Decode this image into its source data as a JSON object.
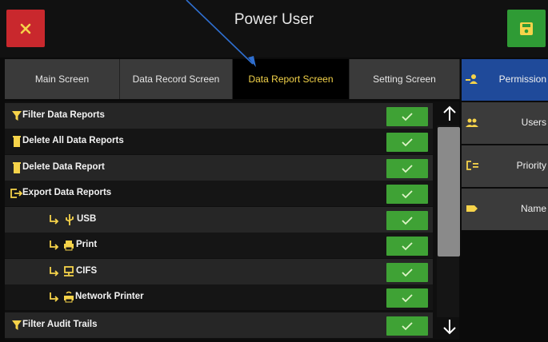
{
  "window": {
    "title": "Power User"
  },
  "tabs": [
    {
      "label": "Main Screen",
      "active": false
    },
    {
      "label": "Data Record Screen",
      "active": false
    },
    {
      "label": "Data Report Screen",
      "active": true
    },
    {
      "label": "Setting Screen",
      "active": false
    }
  ],
  "sidebar": {
    "items": [
      {
        "label": "Permission",
        "icon": "permission-icon",
        "active": true
      },
      {
        "label": "Users",
        "icon": "users-icon",
        "active": false
      },
      {
        "label": "Priority",
        "icon": "priority-icon",
        "active": false
      },
      {
        "label": "Name",
        "icon": "name-tag-icon",
        "active": false
      }
    ]
  },
  "permissions": [
    {
      "label": "Filter Data Reports",
      "icon": "filter-icon",
      "checked": true
    },
    {
      "label": "Delete All Data Reports",
      "icon": "trash-icon",
      "checked": true
    },
    {
      "label": "Delete Data Report",
      "icon": "trash-icon",
      "checked": true
    },
    {
      "label": "Export Data Reports",
      "icon": "export-icon",
      "checked": true
    },
    {
      "label": "USB",
      "icon": "usb-icon",
      "checked": true
    },
    {
      "label": "Print",
      "icon": "printer-icon",
      "checked": true
    },
    {
      "label": "CIFS",
      "icon": "network-share-icon",
      "checked": true
    },
    {
      "label": "Network Printer",
      "icon": "network-printer-icon",
      "checked": true
    },
    {
      "label": "Filter Audit Trails",
      "icon": "filter-icon",
      "checked": true
    }
  ],
  "colors": {
    "accent_yellow": "#f3d34a",
    "check_green": "#3fa235",
    "close_red": "#c9282d",
    "save_green": "#2f9b35",
    "sidebar_active_blue": "#1f4a9a"
  }
}
